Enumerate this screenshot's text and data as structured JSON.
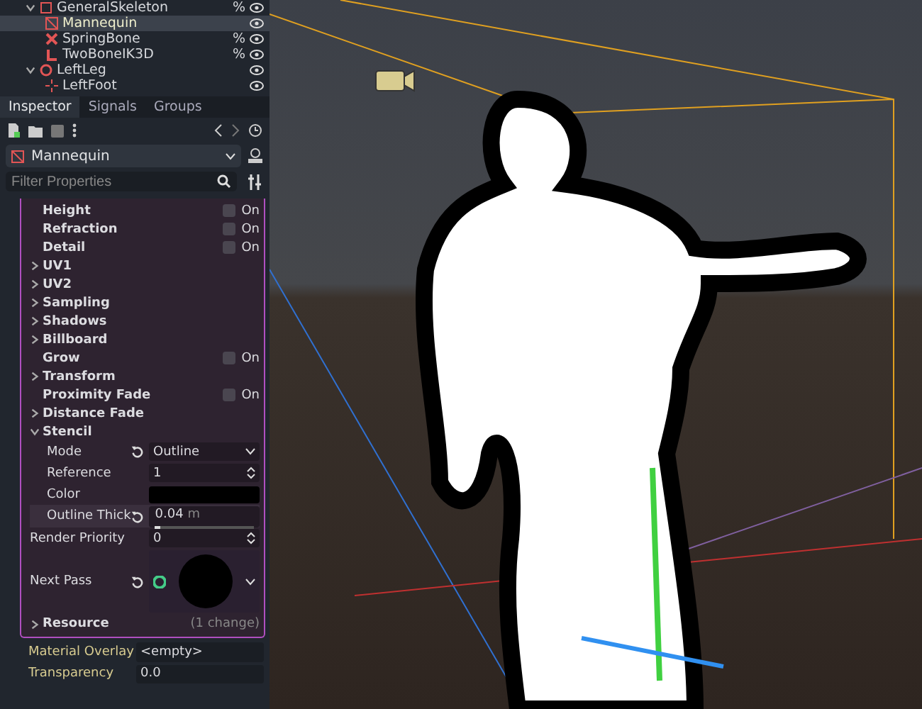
{
  "scene_tree": [
    {
      "label": "GeneralSkeleton",
      "kind": "skeleton",
      "expanded": true,
      "selected": false,
      "badge": "%",
      "children": [
        {
          "label": "Mannequin",
          "kind": "mesh",
          "selected": true
        },
        {
          "label": "SpringBone",
          "kind": "spring",
          "selected": false,
          "badge": "%"
        },
        {
          "label": "TwoBoneIK3D",
          "kind": "ik",
          "selected": false,
          "badge": "%"
        }
      ]
    },
    {
      "label": "LeftLeg",
      "kind": "bone",
      "expanded": true,
      "selected": false,
      "children": [
        {
          "label": "LeftFoot",
          "kind": "marker",
          "selected": false
        }
      ]
    }
  ],
  "tabs": [
    {
      "label": "Inspector",
      "selected": true
    },
    {
      "label": "Signals",
      "selected": false
    },
    {
      "label": "Groups",
      "selected": false
    }
  ],
  "object": {
    "name": "Mannequin"
  },
  "filter": {
    "placeholder": "Filter Properties"
  },
  "properties": [
    {
      "kind": "toggle",
      "label": "Height",
      "text": "On",
      "checked": false
    },
    {
      "kind": "toggle",
      "label": "Refraction",
      "text": "On",
      "checked": false
    },
    {
      "kind": "toggle",
      "label": "Detail",
      "text": "On",
      "checked": false
    },
    {
      "kind": "section",
      "label": "UV1",
      "expanded": false
    },
    {
      "kind": "section",
      "label": "UV2",
      "expanded": false
    },
    {
      "kind": "section",
      "label": "Sampling",
      "expanded": false
    },
    {
      "kind": "section",
      "label": "Shadows",
      "expanded": false
    },
    {
      "kind": "section",
      "label": "Billboard",
      "expanded": false
    },
    {
      "kind": "toggle",
      "label": "Grow",
      "text": "On",
      "checked": false
    },
    {
      "kind": "section",
      "label": "Transform",
      "expanded": false
    },
    {
      "kind": "toggle",
      "label": "Proximity Fade",
      "text": "On",
      "checked": false
    },
    {
      "kind": "section",
      "label": "Distance Fade",
      "expanded": false
    },
    {
      "kind": "section",
      "label": "Stencil",
      "expanded": true,
      "children": [
        {
          "kind": "enum",
          "label": "Mode",
          "value": "Outline",
          "revert": true
        },
        {
          "kind": "spin",
          "label": "Reference",
          "value": "1",
          "revert": false
        },
        {
          "kind": "color",
          "label": "Color",
          "color": "#000000",
          "revert": false
        },
        {
          "kind": "slider",
          "label": "Outline Thick",
          "value": "0.04",
          "unit": "m",
          "level": 0.04,
          "revert": true
        }
      ]
    },
    {
      "kind": "spin",
      "label": "Render Priority",
      "value": "0"
    },
    {
      "kind": "material",
      "label": "Next Pass",
      "revert": true
    },
    {
      "kind": "resource",
      "label": "Resource",
      "note": "(1 change)",
      "expanded": false
    }
  ],
  "material_overlay": {
    "label": "Material Overlay",
    "value": "<empty>"
  },
  "transparency": {
    "label": "Transparency",
    "value": "0.0"
  }
}
